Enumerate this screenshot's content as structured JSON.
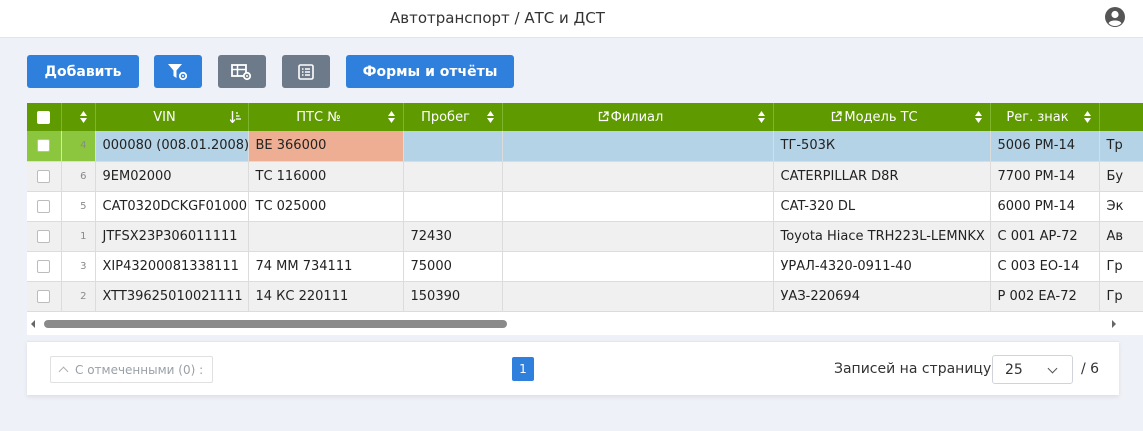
{
  "header": {
    "title": "Автотранспорт / АТС и ДСТ",
    "user_icon": "user-circle-icon"
  },
  "toolbar": {
    "add_label": "Добавить",
    "filter_icon": "filter-settings-icon",
    "table_settings_icon": "table-settings-icon",
    "list_icon": "list-icon",
    "forms_label": "Формы и отчёты",
    "accent": "#2f7fdd",
    "secondary": "#6c7a8a"
  },
  "grid": {
    "header_color": "#5e9a00",
    "selected_row_color": "#b5d3e7",
    "highlight_cell_color": "#eeae93",
    "columns": {
      "vin": "VIN",
      "pts": "ПТС №",
      "mileage": "Пробег",
      "branch": "Филиал",
      "model": "Модель ТС",
      "reg": "Рег. знак"
    },
    "rows": [
      {
        "num": "4",
        "vin": "000080 (008.01.2008)",
        "pts": "ВЕ 366000",
        "mileage": "",
        "branch": "",
        "model": "ТГ-503К",
        "reg": "5006 РМ-14",
        "extra": "Тр"
      },
      {
        "num": "6",
        "vin": "9ЕМ02000",
        "pts": "ТС 116000",
        "mileage": "",
        "branch": "",
        "model": "CATERPILLAR D8R",
        "reg": "7700 РМ-14",
        "extra": "Бу"
      },
      {
        "num": "5",
        "vin": "CAT0320DCKGF01000",
        "pts": "ТС 025000",
        "mileage": "",
        "branch": "",
        "model": "CAT-320 DL",
        "reg": "6000 РМ-14",
        "extra": "Эк"
      },
      {
        "num": "1",
        "vin": "JTFSX23P306011111",
        "pts": "",
        "mileage": "72430",
        "branch": "",
        "model": "Toyota Hiace TRH223L-LEMNKX",
        "reg": "С 001 АР-72",
        "extra": "Ав"
      },
      {
        "num": "3",
        "vin": "XIP43200081338111",
        "pts": "74 ММ 734111",
        "mileage": "75000",
        "branch": "",
        "model": "УРАЛ-4320-0911-40",
        "reg": "С 003 ЕО-14",
        "extra": "Гр"
      },
      {
        "num": "2",
        "vin": "XTT39625010021111",
        "pts": "14 КС 220111",
        "mileage": "150390",
        "branch": "",
        "model": "УАЗ-220694",
        "reg": "Р 002 ЕА-72",
        "extra": "Гр"
      }
    ]
  },
  "pager": {
    "checked_label": "С отмеченными (0) :",
    "current_page": "1",
    "per_page_label": "Записей на страницу:",
    "per_page_value": "25",
    "total_pages": "/ 6"
  }
}
